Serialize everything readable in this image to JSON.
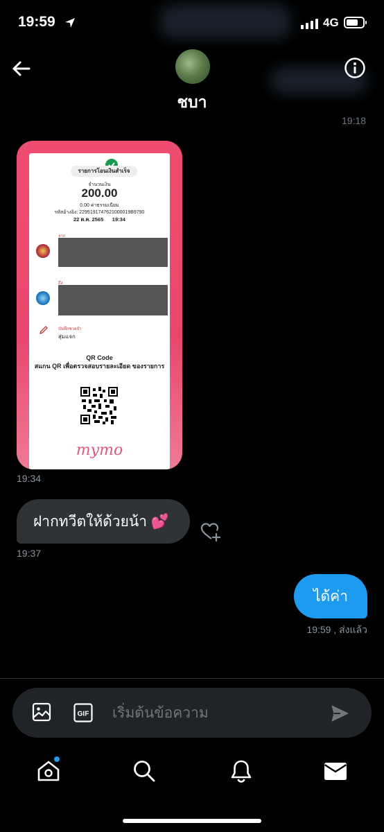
{
  "status_bar": {
    "time": "19:59",
    "network": "4G"
  },
  "header": {
    "contact_name": "ชบา",
    "top_timestamp": "19:18"
  },
  "image_message": {
    "timestamp": "19:34",
    "receipt": {
      "title": "รายการโอนเงินสำเร็จ",
      "amount_label": "จำนวนเงิน",
      "amount": "200.00",
      "fee": "0.00 ค่าธรรมเนียม",
      "reference": "รหัสอ้างอิง: 2295191747621000019B9790",
      "date": "22 ต.ค. 2565",
      "time": "19:34",
      "from_label": "จาก",
      "to_label": "ถึง",
      "memo_label": "บันทึกช่วยจำ",
      "memo_value": "สุ่มแจก",
      "qr_title": "QR Code",
      "qr_subtitle": "สแกน QR เพื่อตรวจสอบรายละเอียด ของรายการ",
      "brand_logo": "mymo"
    }
  },
  "messages": [
    {
      "direction": "incoming",
      "text": "ฝากทวีตให้ด้วยน้า 💕",
      "timestamp": "19:37"
    },
    {
      "direction": "outgoing",
      "text": "ได้ค่า",
      "timestamp": "19:59",
      "status": "ส่งแล้ว",
      "status_line": "19:59 , ส่งแล้ว"
    }
  ],
  "composer": {
    "placeholder": "เริ่มต้นข้อความ",
    "gif_label": "GIF"
  },
  "colors": {
    "accent": "#1d9bf0",
    "incoming_bubble": "#2f3336",
    "background": "#000000",
    "receipt_frame": "#e8476d"
  },
  "icons": [
    "back-arrow-icon",
    "info-icon",
    "heart-plus-icon",
    "image-icon",
    "gif-icon",
    "send-icon",
    "home-icon",
    "search-icon",
    "bell-icon",
    "mail-icon"
  ]
}
